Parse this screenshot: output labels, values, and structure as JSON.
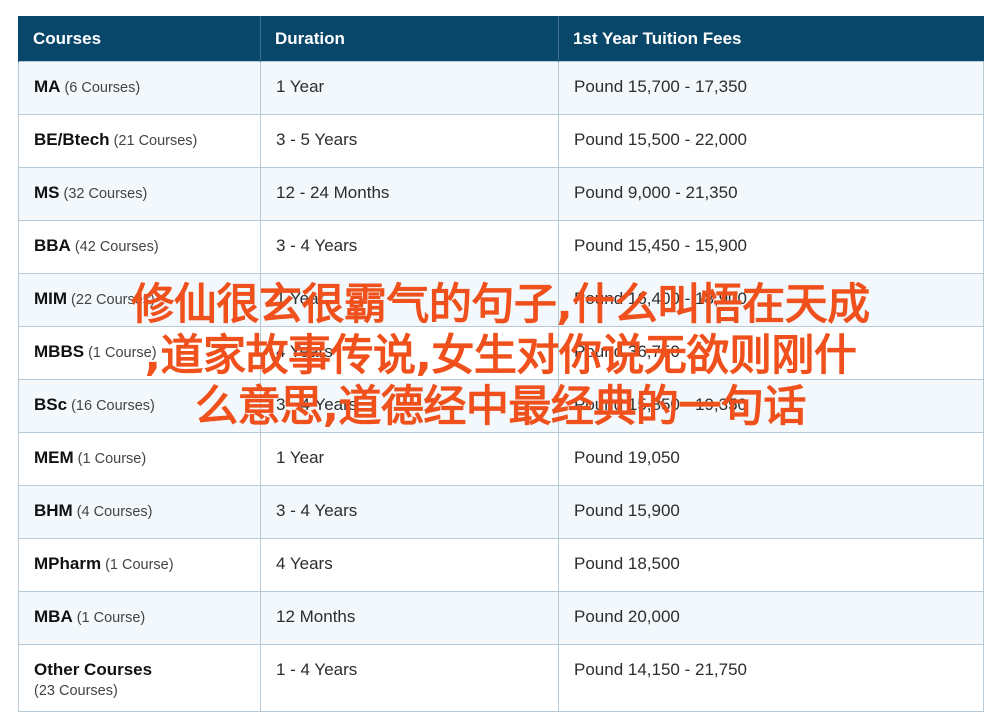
{
  "table": {
    "headers": [
      "Courses",
      "Duration",
      "1st Year Tuition Fees"
    ],
    "rows": [
      {
        "name": "MA",
        "count": "(6 Courses)",
        "duration": "1 Year",
        "fees": "Pound 15,700 - 17,350"
      },
      {
        "name": "BE/Btech",
        "count": "(21 Courses)",
        "duration": "3 - 5 Years",
        "fees": "Pound 15,500 - 22,000"
      },
      {
        "name": "MS",
        "count": "(32 Courses)",
        "duration": "12 - 24 Months",
        "fees": "Pound 9,000 - 21,350"
      },
      {
        "name": "BBA",
        "count": "(42 Courses)",
        "duration": "3 - 4 Years",
        "fees": "Pound 15,450 - 15,900"
      },
      {
        "name": "MIM",
        "count": "(22 Courses)",
        "duration": "1 Year",
        "fees": "Pound 16,400 - 18,900"
      },
      {
        "name": "MBBS",
        "count": "(1 Course)",
        "duration": "4 Years",
        "fees": "Pound 36,750"
      },
      {
        "name": "BSc",
        "count": "(16 Courses)",
        "duration": "3 - 4 Years",
        "fees": "Pound 15,850 - 19,350"
      },
      {
        "name": "MEM",
        "count": "(1 Course)",
        "duration": "1 Year",
        "fees": "Pound 19,050"
      },
      {
        "name": "BHM",
        "count": "(4 Courses)",
        "duration": "3 - 4 Years",
        "fees": "Pound 15,900"
      },
      {
        "name": "MPharm",
        "count": "(1 Course)",
        "duration": "4 Years",
        "fees": "Pound 18,500"
      },
      {
        "name": "MBA",
        "count": "(1 Course)",
        "duration": "12 Months",
        "fees": "Pound 20,000"
      },
      {
        "name": "Other Courses",
        "count": "(23 Courses)",
        "duration": "1 - 4 Years",
        "fees": "Pound 14,150 - 21,750"
      }
    ]
  },
  "watermark": {
    "lines": [
      "修仙很玄很霸气的句子,什么叫悟在天成",
      ",道家故事传说,女生对你说无欲则刚什",
      "么意思,道德经中最经典的一句话"
    ],
    "color": "#f0511c"
  },
  "colors": {
    "header_bg": "#08476a",
    "row_alt_bg": "#f2f8fb",
    "border": "#b8cad6"
  }
}
